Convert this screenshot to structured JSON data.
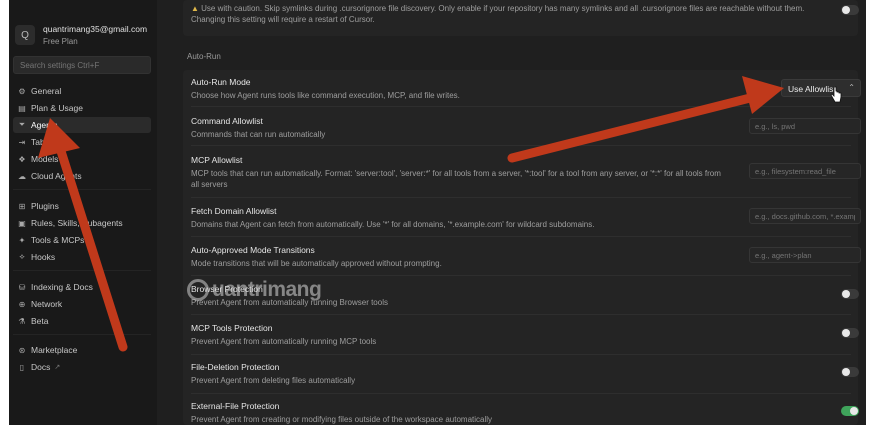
{
  "user": {
    "avatar": "Q",
    "email": "quantrimang35@gmail.com",
    "plan": "Free Plan"
  },
  "search": {
    "placeholder": "Search settings Ctrl+F"
  },
  "nav": {
    "general": "General",
    "plan_usage": "Plan & Usage",
    "agents": "Agents",
    "tab": "Tab",
    "models": "Models",
    "cloud_agents": "Cloud Agents",
    "plugins": "Plugins",
    "rules": "Rules, Skills, Subagents",
    "tools_mcps": "Tools & MCPs",
    "hooks": "Hooks",
    "indexing": "Indexing & Docs",
    "network": "Network",
    "beta": "Beta",
    "marketplace": "Marketplace",
    "docs": "Docs"
  },
  "top_note": {
    "line1": "Use with caution. Skip symlinks during .cursorignore file discovery. Only enable if your repository has many symlinks and all .cursorignore files are reachable without them.",
    "line2": "Changing this setting will require a restart of Cursor."
  },
  "section": "Auto-Run",
  "auto_run_mode": {
    "title": "Auto-Run Mode",
    "desc": "Choose how Agent runs tools like command execution, MCP, and file writes.",
    "value": "Use Allowlist"
  },
  "command_allowlist": {
    "title": "Command Allowlist",
    "desc": "Commands that can run automatically",
    "placeholder": "e.g., ls, pwd"
  },
  "mcp_allowlist": {
    "title": "MCP Allowlist",
    "desc": "MCP tools that can run automatically. Format: 'server:tool', 'server:*' for all tools from a server, '*:tool' for a tool from any server, or '*:*' for all tools from all servers",
    "placeholder": "e.g., filesystem:read_file"
  },
  "fetch_domain": {
    "title": "Fetch Domain Allowlist",
    "desc": "Domains that Agent can fetch from automatically. Use '*' for all domains, '*.example.com' for wildcard subdomains.",
    "placeholder": "e.g., docs.github.com, *.example.com"
  },
  "mode_transitions": {
    "title": "Auto-Approved Mode Transitions",
    "desc": "Mode transitions that will be automatically approved without prompting.",
    "placeholder": "e.g., agent->plan"
  },
  "browser_protection": {
    "title": "Browser Protection",
    "desc": "Prevent Agent from automatically running Browser tools",
    "on": false
  },
  "mcp_tools_protection": {
    "title": "MCP Tools Protection",
    "desc": "Prevent Agent from automatically running MCP tools",
    "on": false
  },
  "file_deletion": {
    "title": "File-Deletion Protection",
    "desc": "Prevent Agent from deleting files automatically",
    "on": false
  },
  "external_file": {
    "title": "External-File Protection",
    "desc": "Prevent Agent from creating or modifying files outside of the workspace automatically",
    "on": true
  },
  "watermark": "uantrimang",
  "colors": {
    "arrow": "#c0391b",
    "toggle_on": "#3fa45b",
    "background": "#1f1f1f"
  }
}
